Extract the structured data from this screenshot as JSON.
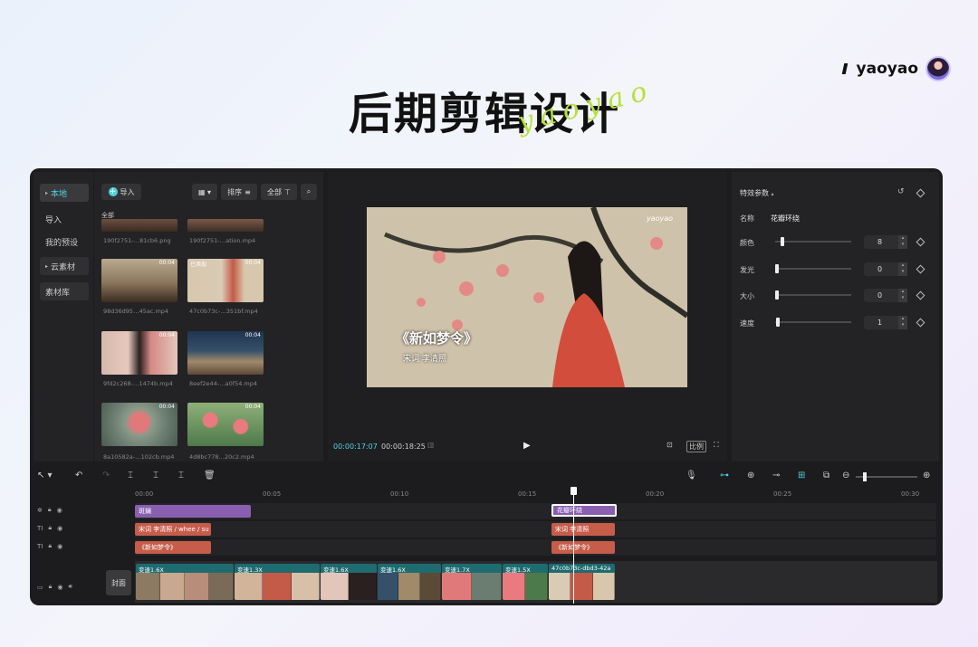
{
  "header": {
    "title": "后期剪辑设计",
    "script": "yaoyao",
    "brand": "yaoyao"
  },
  "nav": {
    "items": [
      "本地",
      "导入",
      "我的预设",
      "云素材",
      "素材库"
    ]
  },
  "media": {
    "import_label": "导入",
    "sort_label": "排序",
    "filter_label": "全部",
    "all_label": "全部",
    "items": [
      {
        "name": "190f2751-…81cb6.png",
        "duration": "",
        "tag": ""
      },
      {
        "name": "190f2751-…ation.mp4",
        "duration": "",
        "tag": ""
      },
      {
        "name": "98d36d95…45ac.mp4",
        "duration": "00:04",
        "tag": ""
      },
      {
        "name": "47c0b73c-…351bf.mp4",
        "duration": "00:04",
        "tag": "已添加"
      },
      {
        "name": "9fd2c268-…1474b.mp4",
        "duration": "00:04",
        "tag": ""
      },
      {
        "name": "8eef2e44-…a0f54.mp4",
        "duration": "00:04",
        "tag": ""
      },
      {
        "name": "8a10582a-…102cb.mp4",
        "duration": "00:04",
        "tag": ""
      },
      {
        "name": "4d8bc778…20c2.mp4",
        "duration": "00:04",
        "tag": ""
      }
    ]
  },
  "viewer": {
    "watermark": "yaoyao",
    "subtitle_title": "《新如梦令》",
    "subtitle_author": "宋词 李清照",
    "time_current": "00:00:17:07",
    "time_total": "00:00:18:25",
    "ratio_label": "比例"
  },
  "props": {
    "title": "特效参数",
    "name_label": "名称",
    "name_value": "花瓣环绕",
    "params": [
      {
        "label": "颜色",
        "value": "8",
        "level": 0.08
      },
      {
        "label": "发光",
        "value": "0",
        "level": 0
      },
      {
        "label": "大小",
        "value": "0",
        "level": 0
      },
      {
        "label": "速度",
        "value": "1",
        "level": 0.01
      }
    ]
  },
  "timeline": {
    "ticks": [
      "00:00",
      "00:05",
      "00:10",
      "00:15",
      "00:20",
      "00:25",
      "00:30"
    ],
    "cover_label": "封面",
    "effect_clips": [
      "斑斓",
      "花瓣环绕"
    ],
    "text_clips_1": [
      "宋词 李清照 / whee / su",
      "宋词 李清照"
    ],
    "text_clips_2": [
      "《新如梦令》",
      "《新如梦令》"
    ],
    "video_clips": [
      "变速1.6X",
      "变速1.3X",
      "变速1.6X",
      "变速1.6X",
      "变速1.7X",
      "变速1.5X",
      "47c0b73c-dbd3-42a"
    ]
  },
  "colors": {
    "accent": "#4fd3e0",
    "purple_clip": "#8a5fb0",
    "red_clip": "#c65c4a",
    "teal_clip": "#1e6b70"
  }
}
